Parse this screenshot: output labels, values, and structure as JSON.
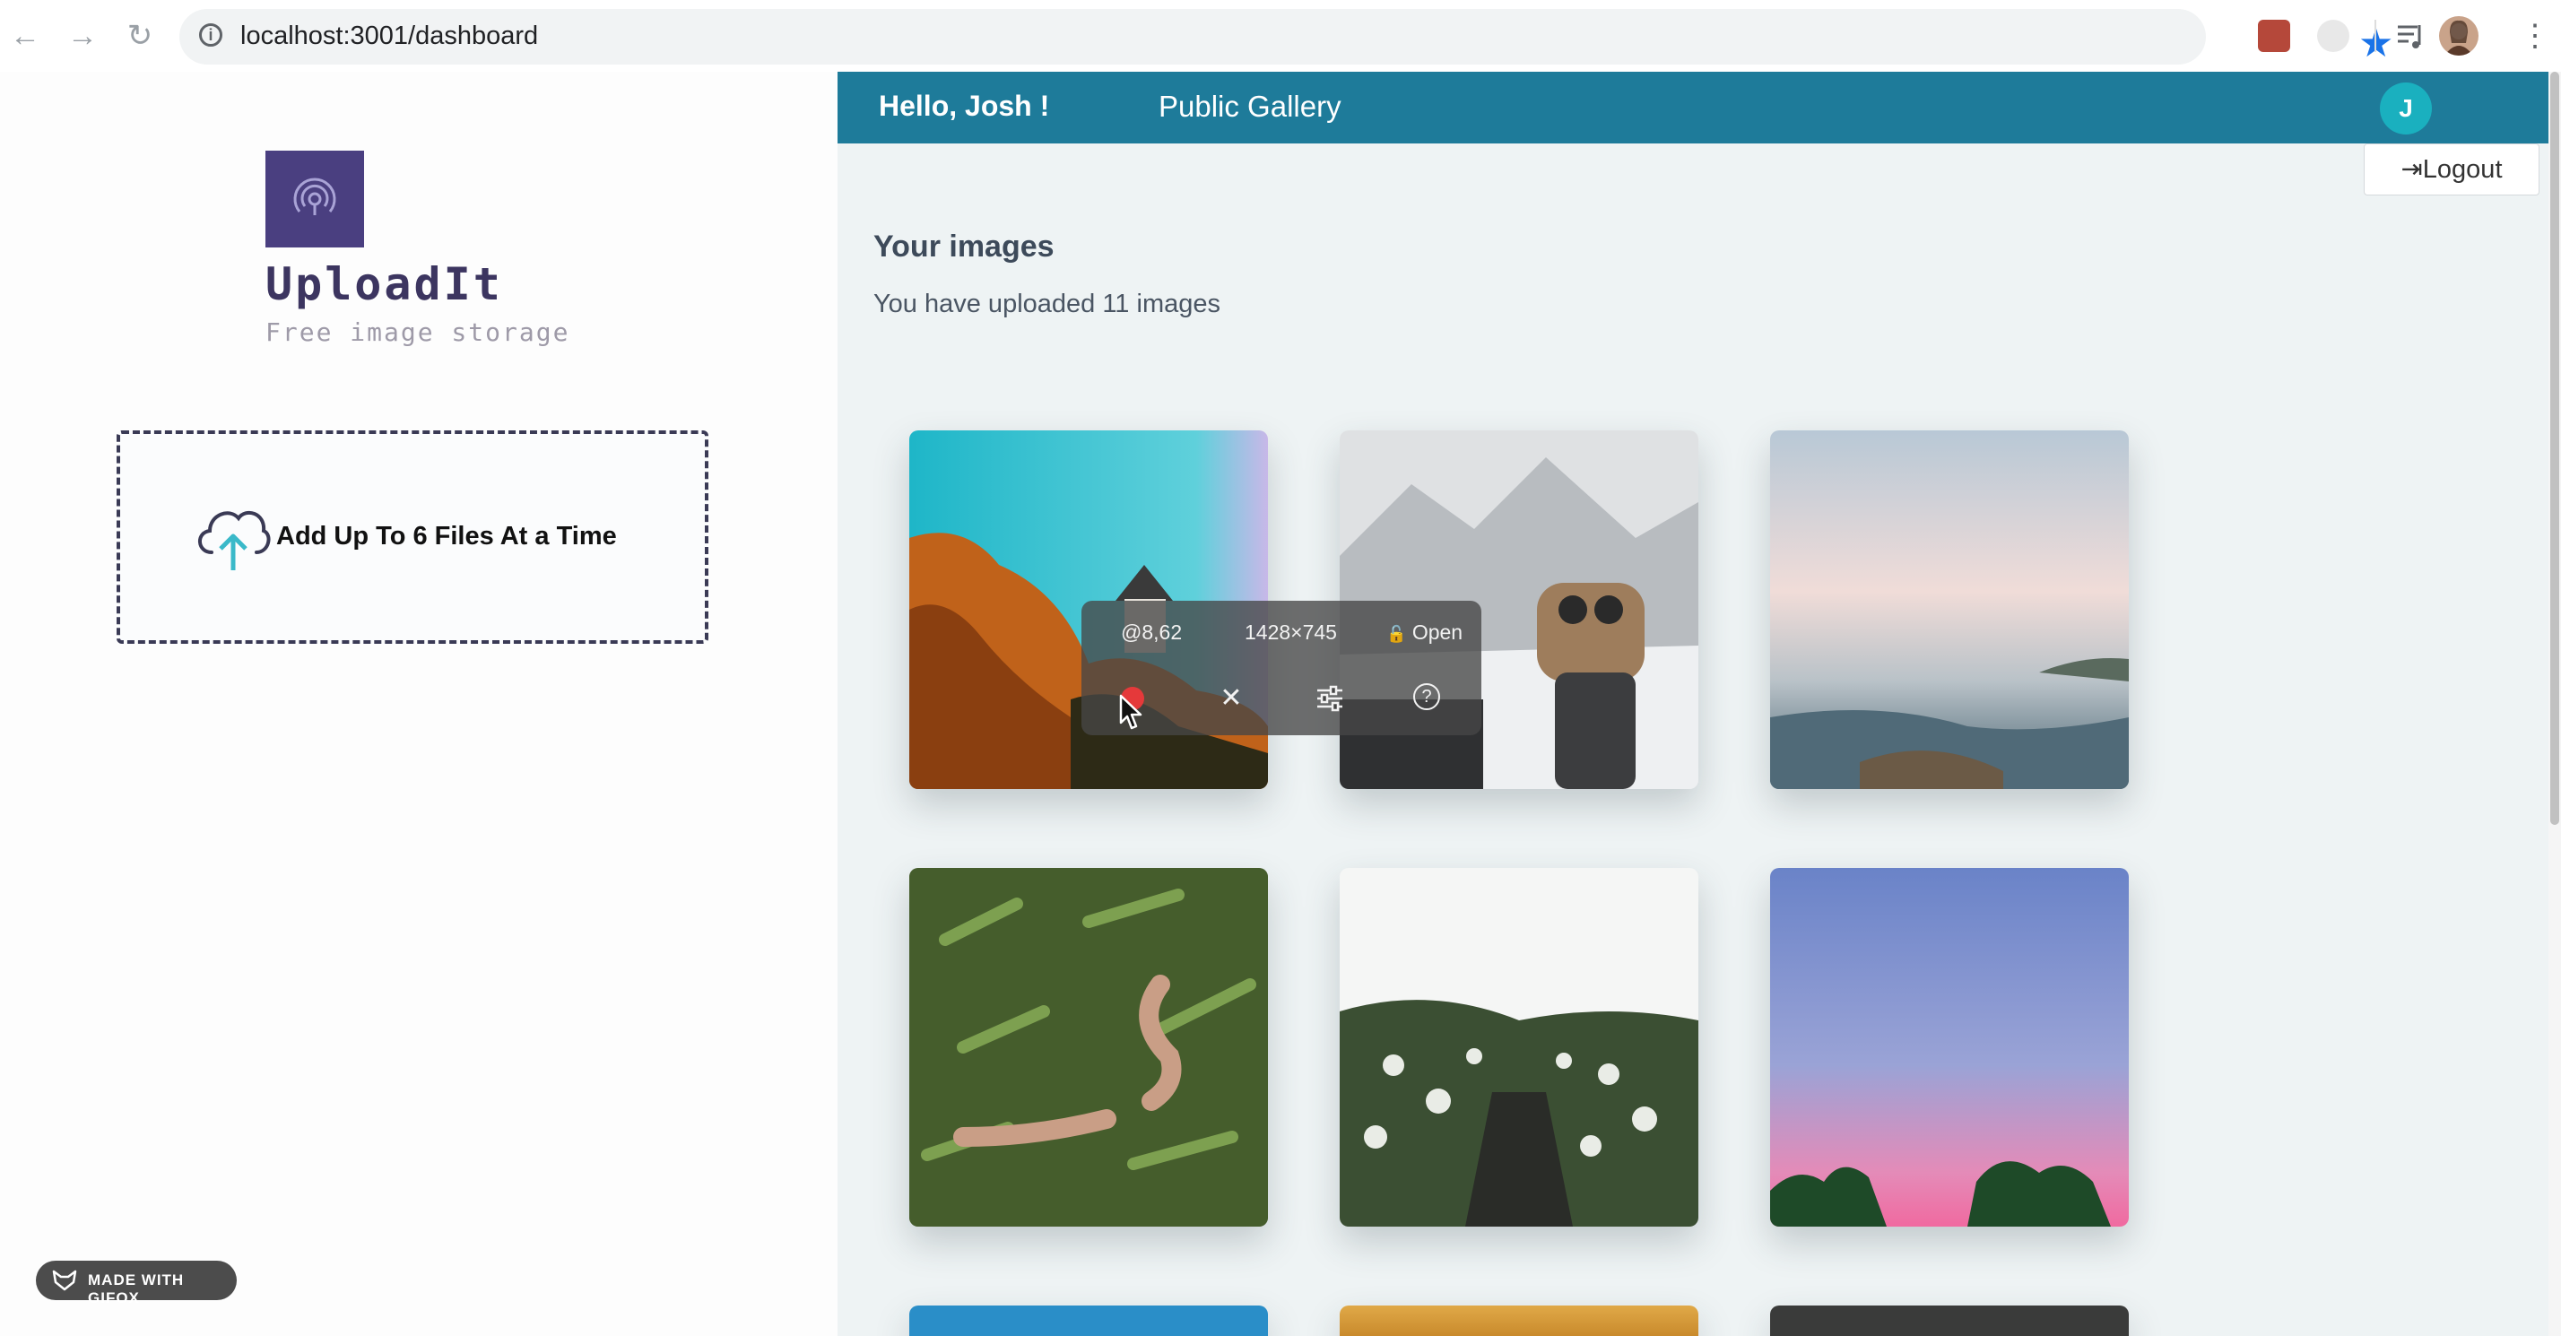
{
  "browser": {
    "url": "localhost:3001/dashboard",
    "back_icon": "←",
    "forward_icon": "→",
    "reload_icon": "↻",
    "info_icon": "i",
    "star_icon": "★",
    "menu_icon": "⋮"
  },
  "sidebar": {
    "app_name": "UploadIt",
    "tagline": "Free image storage",
    "dropzone_label": "Add Up To 6 Files At a Time"
  },
  "header": {
    "greeting": "Hello, Josh !",
    "gallery_link": "Public Gallery",
    "avatar_initial": "J",
    "logout_label": "Logout",
    "logout_icon": "⇥"
  },
  "main": {
    "heading": "Your images",
    "count_text": "You have uploaded 11 images"
  },
  "images": [
    {
      "name": "castle-autumn-tree"
    },
    {
      "name": "snowy-mountain-binoculars"
    },
    {
      "name": "sea-waves"
    },
    {
      "name": "hands-in-plants"
    },
    {
      "name": "flower-path"
    },
    {
      "name": "purple-sky-trees"
    },
    {
      "name": "blue-partial"
    },
    {
      "name": "orange-partial"
    },
    {
      "name": "dark-partial"
    }
  ],
  "capture_overlay": {
    "position_text": "@8,62",
    "size_text": "1428×745",
    "mode_text": "Open",
    "lock_icon": "🔓",
    "close_icon": "✕",
    "settings_icon": "⚙",
    "help_icon": "?"
  },
  "gifox_badge": "MADE WITH GIFOX",
  "colors": {
    "header_bg": "#1e7b9a",
    "avatar_bg": "#1ab0bf",
    "logo_bg": "#4a3f80",
    "record": "#e5393a"
  }
}
